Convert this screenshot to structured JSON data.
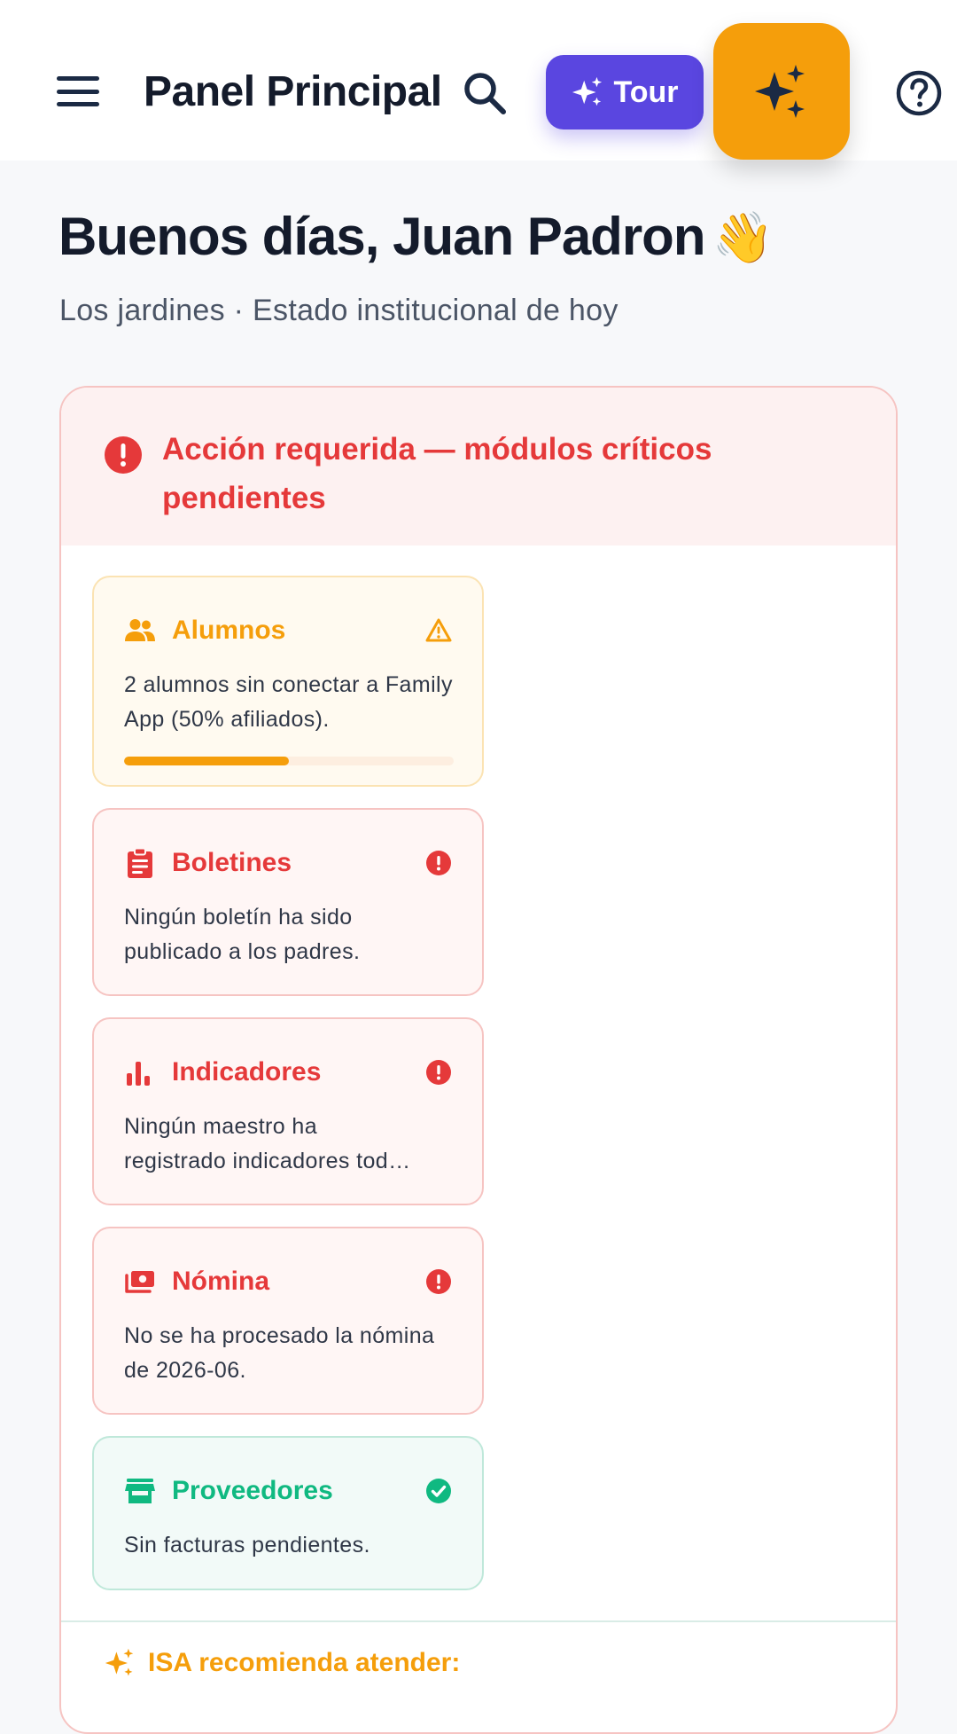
{
  "header": {
    "title": "Panel Principal",
    "tour_label": "Tour"
  },
  "greeting": {
    "text": "Buenos días, Juan Padron",
    "emoji": "👋",
    "subtitle": "Los jardines · Estado institucional de hoy"
  },
  "alert": {
    "title": "Acción requerida — módulos críticos pendientes",
    "cards": [
      {
        "title": "Alumnos",
        "text": "2 alumnos sin conectar a Family App (50% afiliados).",
        "status": "warning",
        "icon": "users-icon",
        "progress": 0.5
      },
      {
        "title": "Boletines",
        "text": "Ningún boletín ha sido publicado a los padres.",
        "status": "error",
        "icon": "clipboard-icon"
      },
      {
        "title": "Indicadores",
        "text": "Ningún maestro ha registrado indicadores tod…",
        "status": "error",
        "icon": "bar-chart-icon"
      },
      {
        "title": "Nómina",
        "text": "No se ha procesado la nómina de 2026-06.",
        "status": "error",
        "icon": "payments-icon"
      },
      {
        "title": "Proveedores",
        "text": "Sin facturas pendientes.",
        "status": "ok",
        "icon": "store-icon"
      }
    ]
  },
  "isa": {
    "title": "ISA recomienda atender:"
  },
  "colors": {
    "accent_purple": "#5a46e0",
    "accent_orange": "#f59e0b",
    "danger": "#e5393a",
    "success": "#10b981"
  }
}
